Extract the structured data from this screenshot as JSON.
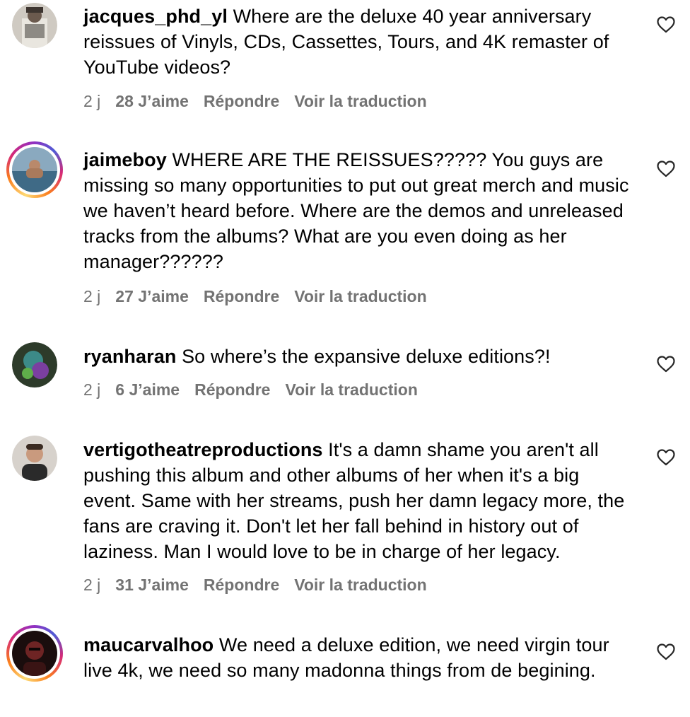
{
  "comments": [
    {
      "username": "jacques_phd_yl",
      "text": " Where are the deluxe 40 year anniversary reissues of Vinyls, CDs, Cassettes, Tours, and 4K remaster of YouTube videos?",
      "time": "2 j",
      "likes": "28 J’aime",
      "reply": "Répondre",
      "translate": "Voir la traduction",
      "avatar_icon": "user-photo-avatar",
      "story_ring": false
    },
    {
      "username": "jaimeboy",
      "text": " WHERE ARE THE REISSUES????? You guys are missing so many opportunities to put out great merch and music we haven’t heard before. Where are the demos and unreleased tracks from the albums? What are you even doing as her manager??????",
      "time": "2 j",
      "likes": "27 J’aime",
      "reply": "Répondre",
      "translate": "Voir la traduction",
      "avatar_icon": "user-photo-avatar",
      "story_ring": true
    },
    {
      "username": "ryanharan",
      "text": " So where’s the expansive deluxe editions?!",
      "time": "2 j",
      "likes": "6 J’aime",
      "reply": "Répondre",
      "translate": "Voir la traduction",
      "avatar_icon": "user-photo-avatar",
      "story_ring": false
    },
    {
      "username": "vertigotheatreproductions",
      "text": " It's a damn shame you aren't all pushing this album and other albums of her when it's a big event. Same with her streams, push her damn legacy more, the fans are craving it. Don't let her fall behind in history out of laziness. Man I would love to be in charge of her legacy.",
      "time": "2 j",
      "likes": "31 J’aime",
      "reply": "Répondre",
      "translate": "Voir la traduction",
      "avatar_icon": "user-photo-avatar",
      "story_ring": false
    },
    {
      "username": "maucarvalhoo",
      "text": " We need a deluxe edition, we need virgin tour live 4k, we need so many madonna things from de begining.",
      "time": "",
      "likes": "",
      "reply": "",
      "translate": "",
      "avatar_icon": "user-photo-avatar",
      "story_ring": true
    }
  ],
  "icons": {
    "like": "heart-outline-icon"
  },
  "colors": {
    "text": "#000000",
    "meta": "#737373",
    "ring_start": "#feda75",
    "ring_mid": "#d62976",
    "ring_end": "#962fbf"
  }
}
